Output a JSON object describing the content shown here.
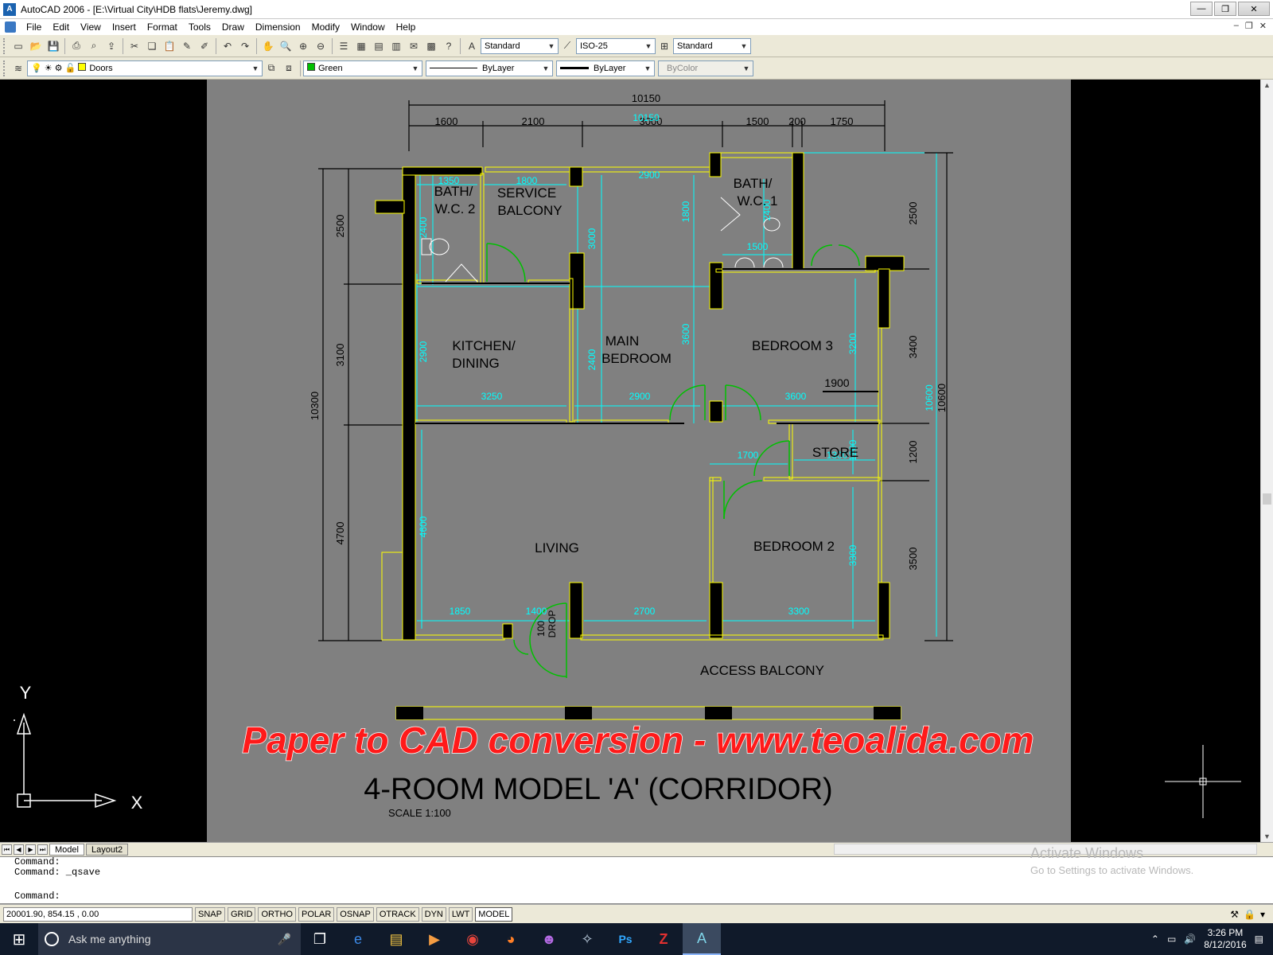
{
  "window": {
    "title": "AutoCAD 2006 - [E:\\Virtual City\\HDB flats\\Jeremy.dwg]",
    "btn_minimize": "—",
    "btn_restore": "❐",
    "btn_close": "✕"
  },
  "menu": {
    "items": [
      "File",
      "Edit",
      "View",
      "Insert",
      "Format",
      "Tools",
      "Draw",
      "Dimension",
      "Modify",
      "Window",
      "Help"
    ],
    "doc_btns": [
      "–",
      "❐",
      "✕"
    ]
  },
  "toolbar1": {
    "text_style": "Standard",
    "dim_style": "ISO-25",
    "table_style": "Standard"
  },
  "toolbar2": {
    "layer": "Doors",
    "color": "Green",
    "linetype": "ByLayer",
    "lineweight": "ByLayer",
    "plotstyle": "ByColor"
  },
  "drawing": {
    "overall_width": "10150",
    "top_dims": [
      "1600",
      "2100",
      "3000",
      "1500",
      "200",
      "1750"
    ],
    "top_overlay_dim": "10150",
    "left_overall": "10300",
    "left_dims": [
      "2500",
      "3100",
      "4700"
    ],
    "right_overall": "10600",
    "right_overlay": "10600",
    "right_dims": [
      "2500",
      "3400",
      "1200",
      "3500"
    ],
    "rooms": {
      "bath2": [
        "BATH/",
        "W.C. 2"
      ],
      "service": [
        "SERVICE",
        "BALCONY"
      ],
      "bath1": [
        "BATH/",
        "W.C. 1"
      ],
      "kitchen": [
        "KITCHEN/",
        "DINING"
      ],
      "main_bed": [
        "MAIN",
        "BEDROOM"
      ],
      "bed3": "BEDROOM 3",
      "store": "STORE",
      "living": "LIVING",
      "bed2": "BEDROOM 2",
      "access": "ACCESS BALCONY",
      "drop": [
        "100",
        "DROP"
      ]
    },
    "inner_dims": {
      "d1350": "1350",
      "d1800a": "1800",
      "d2900a": "2900",
      "d2400a": "2400",
      "d3000": "3000",
      "d1800b": "1800",
      "d2400b": "2400",
      "d1500": "1500",
      "d2900b": "2900",
      "d2400c": "2400",
      "d3600v": "3600",
      "d3200": "3200",
      "d1900": "1900",
      "d3250": "3250",
      "d2900c": "2900",
      "d3600h": "3600",
      "d1700": "1700",
      "d1300": "1300",
      "d1200": "1200",
      "d4600": "4600",
      "d3300v": "3300",
      "d1850": "1850",
      "d1400": "1400",
      "d2700": "2700",
      "d3300h": "3300"
    },
    "watermark": "Paper to CAD conversion - www.teoalida.com",
    "plan_title": "4-ROOM MODEL 'A' (CORRIDOR)",
    "scale": "SCALE   1:100",
    "ucs_y": "Y",
    "ucs_x": "X"
  },
  "tabs": [
    "Model",
    "Layout2"
  ],
  "command": {
    "lines": [
      "Command:",
      "Command: _qsave"
    ],
    "prompt": "Command:"
  },
  "activate": {
    "title": "Activate Windows",
    "sub": "Go to Settings to activate Windows."
  },
  "status": {
    "coords": "20001.90, 854.15 , 0.00",
    "buttons": [
      "SNAP",
      "GRID",
      "ORTHO",
      "POLAR",
      "OSNAP",
      "OTRACK",
      "DYN",
      "LWT",
      "MODEL"
    ]
  },
  "taskbar": {
    "search_placeholder": "Ask me anything",
    "time": "3:26 PM",
    "date": "8/12/2016"
  },
  "colors": {
    "paper": "#808080",
    "walls": "#000000",
    "wall_edge": "#ffff00",
    "dims": "#00ffff",
    "doors": "#00a000",
    "watermark": "#ff0000"
  }
}
